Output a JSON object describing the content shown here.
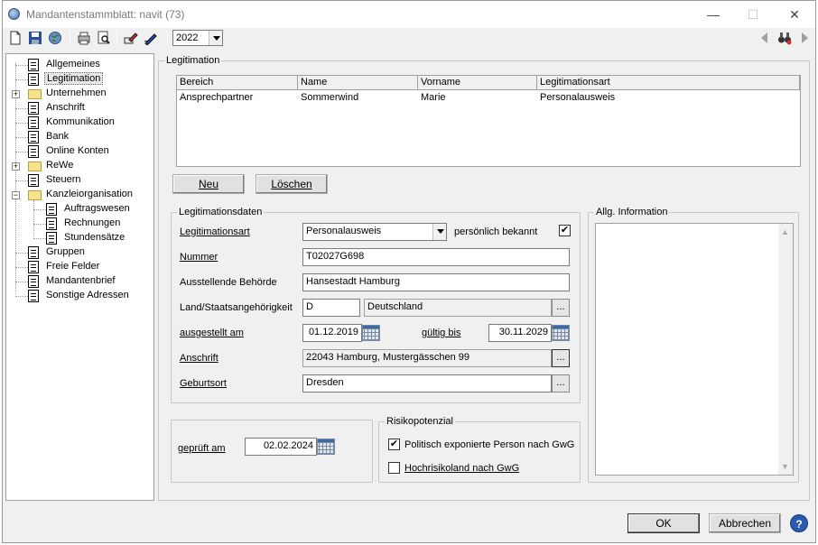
{
  "window": {
    "title": "Mandantenstammblatt: navit (73)",
    "minimize_glyph": "—",
    "maximize_glyph": "☐",
    "close_glyph": "✕"
  },
  "toolbar": {
    "year_value": "2022"
  },
  "tree": {
    "items": [
      {
        "label": "Allgemeines"
      },
      {
        "label": "Legitimation"
      },
      {
        "label": "Unternehmen"
      },
      {
        "label": "Anschrift"
      },
      {
        "label": "Kommunikation"
      },
      {
        "label": "Bank"
      },
      {
        "label": "Online Konten"
      },
      {
        "label": "ReWe"
      },
      {
        "label": "Steuern"
      },
      {
        "label": "Kanzleiorganisation"
      },
      {
        "label": "Auftragswesen"
      },
      {
        "label": "Rechnungen"
      },
      {
        "label": "Stundensätze"
      },
      {
        "label": "Gruppen"
      },
      {
        "label": "Freie Felder"
      },
      {
        "label": "Mandantenbrief"
      },
      {
        "label": "Sonstige Adressen"
      }
    ]
  },
  "legitimation": {
    "group_title": "Legitimation",
    "columns": [
      "Bereich",
      "Name",
      "Vorname",
      "Legitimationsart"
    ],
    "rows": [
      [
        "Ansprechpartner",
        "Sommerwind",
        "Marie",
        "Personalausweis"
      ]
    ],
    "new_button": "Neu",
    "delete_button": "Löschen"
  },
  "legdaten": {
    "group_title": "Legitimationsdaten",
    "art_label": "Legitimationsart",
    "art_value": "Personalausweis",
    "personal_label": "persönlich bekannt",
    "personal_checked": "✔",
    "nummer_label": "Nummer",
    "nummer_value": "T02027G698",
    "behoerde_label": "Ausstellende Behörde",
    "behoerde_value": "Hansestadt Hamburg",
    "land_label": "Land/Staatsangehörigkeit",
    "land_code": "D",
    "land_name": "Deutschland",
    "ausgestellt_label": "ausgestellt am",
    "ausgestellt_value": "01.12.2019",
    "gueltig_label": "gültig bis",
    "gueltig_value": "30.11.2029",
    "anschrift_label": "Anschrift",
    "anschrift_value": "22043 Hamburg, Mustergässchen 99",
    "geburtsort_label": "Geburtsort",
    "geburtsort_value": "Dresden",
    "ellipsis": "..."
  },
  "info": {
    "group_title": "Allg. Information"
  },
  "pruefung": {
    "label": "geprüft am",
    "value": "02.02.2024"
  },
  "risiko": {
    "group_title": "Risikopotenzial",
    "pep_label": "Politisch exponierte Person nach GwG",
    "pep_checked": "✔",
    "hochrisiko_label": "Hochrisikoland nach GwG"
  },
  "footer": {
    "ok_label": "OK",
    "cancel_label": "Abbrechen",
    "help_glyph": "?"
  },
  "colors": {
    "window_bg": "#f0f0f0",
    "selection": "#e8e8e8"
  }
}
